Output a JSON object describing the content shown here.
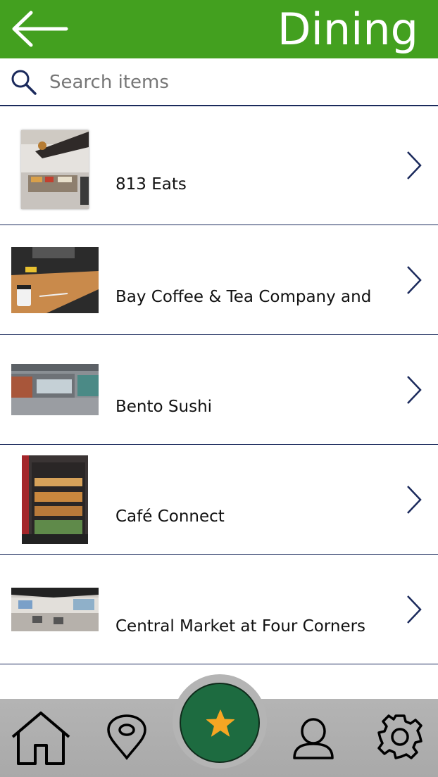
{
  "header": {
    "title": "Dining",
    "back_icon": "arrow-left-icon",
    "background_color": "#43a01f"
  },
  "search": {
    "placeholder": "Search items",
    "value": "",
    "icon": "search-icon"
  },
  "list": {
    "items": [
      {
        "label": "813 Eats",
        "icon": "chevron-right-icon"
      },
      {
        "label": "Bay Coffee & Tea Company and",
        "icon": "chevron-right-icon"
      },
      {
        "label": "Bento Sushi",
        "icon": "chevron-right-icon"
      },
      {
        "label": "Café Connect",
        "icon": "chevron-right-icon"
      },
      {
        "label": "Central Market at Four Corners",
        "icon": "chevron-right-icon"
      }
    ]
  },
  "nav": {
    "items": [
      {
        "name": "home",
        "icon": "home-icon"
      },
      {
        "name": "location",
        "icon": "map-pin-icon"
      },
      {
        "name": "favorites",
        "icon": "star-icon",
        "active": true
      },
      {
        "name": "profile",
        "icon": "user-icon"
      },
      {
        "name": "settings",
        "icon": "gear-icon"
      }
    ],
    "fab_color": "#1d6b40",
    "star_color": "#f6a623"
  }
}
